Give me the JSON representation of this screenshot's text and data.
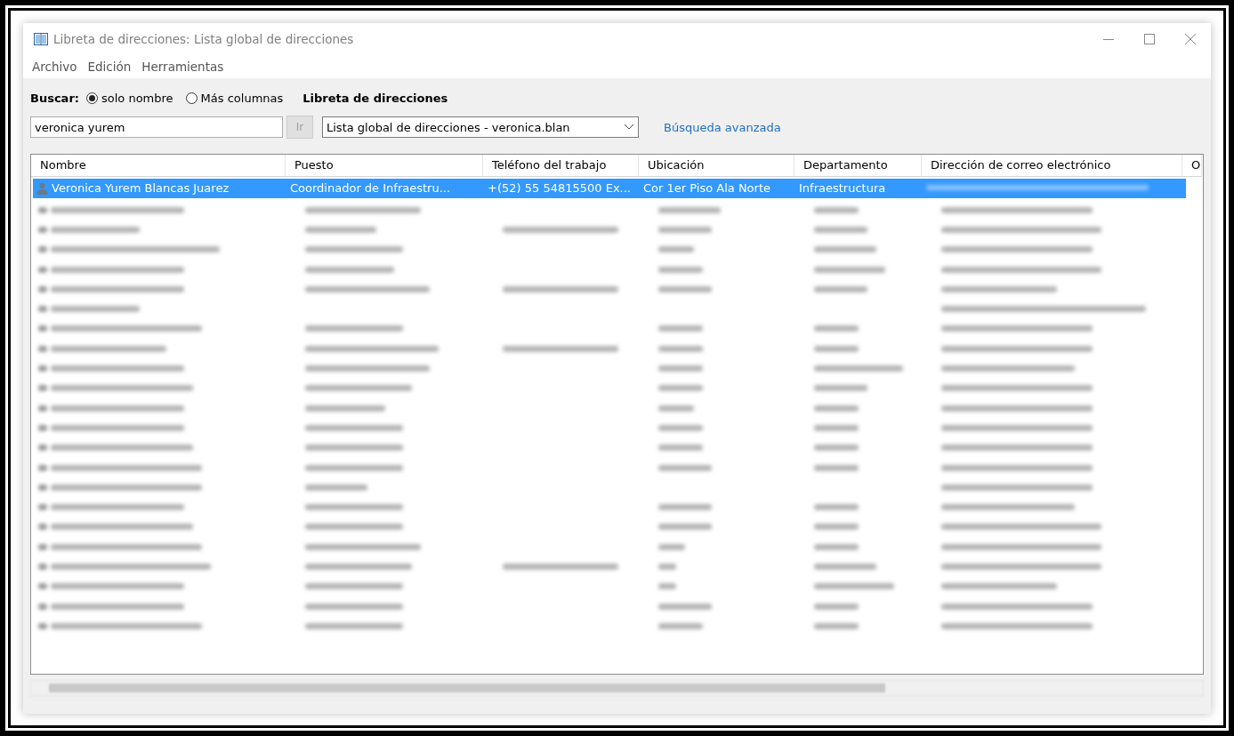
{
  "window": {
    "title": "Libreta de direcciones: Lista global de direcciones"
  },
  "menu": [
    "Archivo",
    "Edición",
    "Herramientas"
  ],
  "search": {
    "label": "Buscar:",
    "options": [
      {
        "label": "solo nombre",
        "selected": true
      },
      {
        "label": "Más columnas",
        "selected": false
      }
    ],
    "value": "veronica yurem",
    "go_button": {
      "label": "Ir",
      "disabled": true
    }
  },
  "address_book": {
    "label": "Libreta de direcciones",
    "value": "Lista global de direcciones - veronica.blan"
  },
  "advanced_search": "Búsqueda avanzada",
  "table": {
    "columns": [
      "Nombre",
      "Puesto",
      "Teléfono del trabajo",
      "Ubicación",
      "Departamento",
      "Dirección de correo electrónico",
      "O"
    ],
    "rows": [
      {
        "cells": [
          "Veronica Yurem Blancas Juarez",
          "Coordinador de Infraestru...",
          "+(52) 55 54815500 Ex...",
          "Cor 1er Piso Ala Norte",
          "Infraestructura"
        ],
        "selected": true
      }
    ]
  }
}
